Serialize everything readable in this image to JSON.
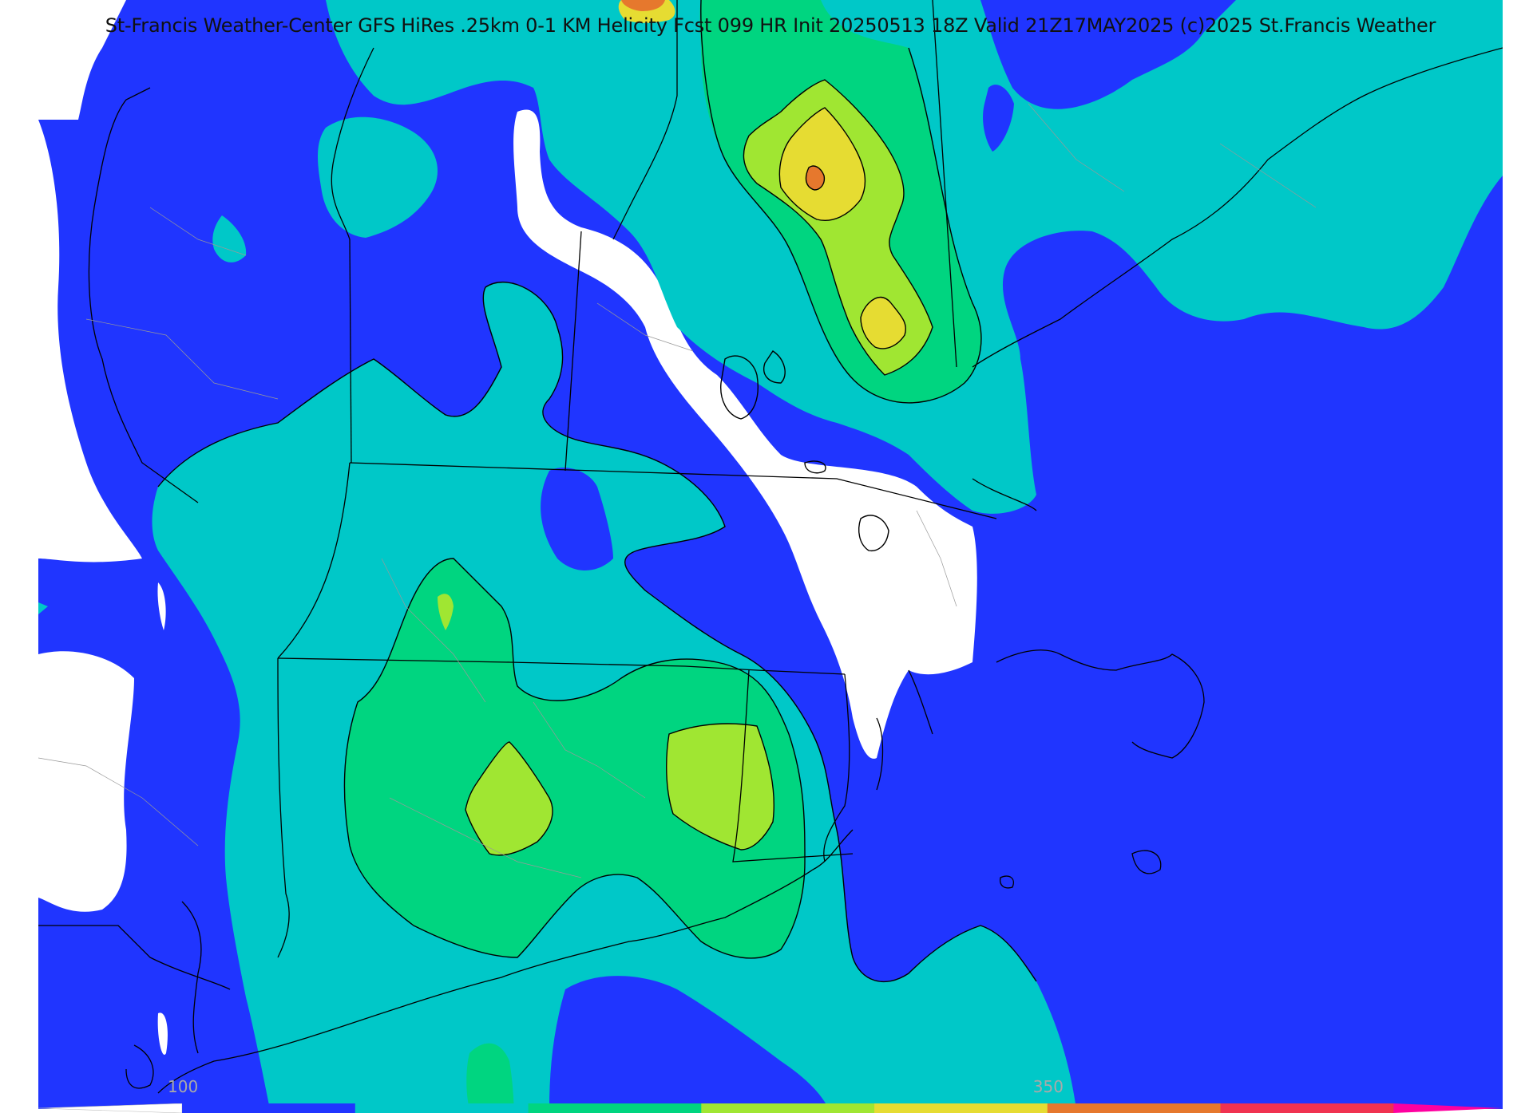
{
  "title": "St-Francis Weather-Center GFS HiRes .25km 0-1 KM Helicity Fcst 099 HR Init 20250513 18Z  Valid 21Z17MAY2025    (c)2025 St.Francis Weather",
  "colorbar": {
    "tick_labels": [
      {
        "value": 100,
        "text": "100"
      },
      {
        "value": 350,
        "text": "350"
      }
    ],
    "levels": [
      50,
      100,
      150,
      200,
      250,
      300,
      350,
      400,
      450,
      500
    ],
    "colors": [
      "#ffffff",
      "#2035ff",
      "#00c8c8",
      "#00d580",
      "#a0e632",
      "#e6dc32",
      "#e6782d",
      "#f03250",
      "#ff00a0"
    ]
  },
  "colors": {
    "ocean_background": "#2035ff",
    "level_white": "#ffffff",
    "level_blue": "#2035ff",
    "level_cyan": "#00c8c8",
    "level_green": "#00d580",
    "level_lime": "#a0e632",
    "level_yellow": "#e6dc32",
    "level_orange": "#e6782d",
    "coastline": "#000000",
    "county_lines": "#999999"
  }
}
